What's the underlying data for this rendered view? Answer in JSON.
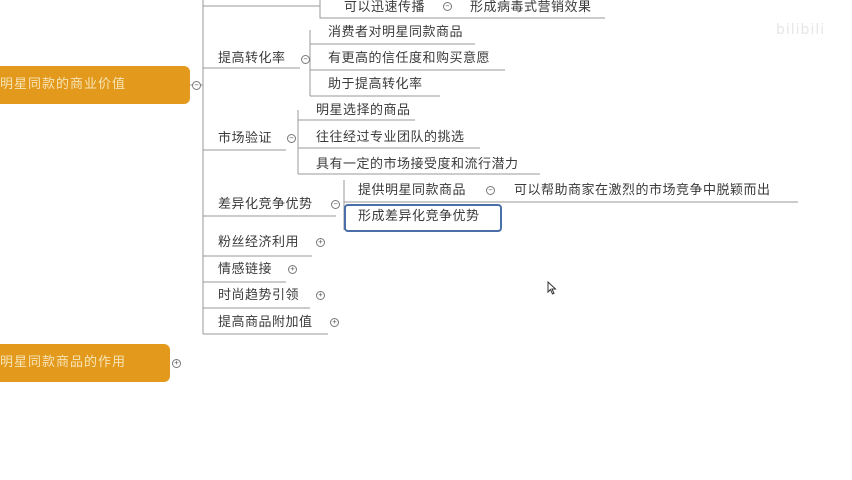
{
  "roots": [
    {
      "label": "明星同款的商业价值"
    },
    {
      "label": "明星同款商品的作用"
    }
  ],
  "branches": {
    "conversion": {
      "label": "提高转化率",
      "children": [
        "消费者对明星同款商品",
        "有更高的信任度和购买意愿",
        "助于提高转化率"
      ]
    },
    "market": {
      "label": "市场验证",
      "children": [
        "明星选择的商品",
        "往往经过专业团队的挑选",
        "具有一定的市场接受度和流行潜力"
      ]
    },
    "differentiation": {
      "label": "差异化竞争优势",
      "child1": "提供明星同款商品",
      "child1_note": "可以帮助商家在激烈的市场竞争中脱颖而出",
      "child2": "形成差异化竞争优势"
    },
    "fans": {
      "label": "粉丝经济利用"
    },
    "emotion": {
      "label": "情感链接"
    },
    "fashion": {
      "label": "时尚趋势引领"
    },
    "value": {
      "label": "提高商品附加值"
    }
  },
  "top_partial": {
    "left": "可以迅速传播",
    "right": "形成病毒式营销效果"
  },
  "toggles": {
    "collapse": "−",
    "expand": "+"
  },
  "watermark": "bilibili",
  "colors": {
    "root": "#e39a1c",
    "selection": "#4a6ea8",
    "line": "#9a9a9a"
  }
}
